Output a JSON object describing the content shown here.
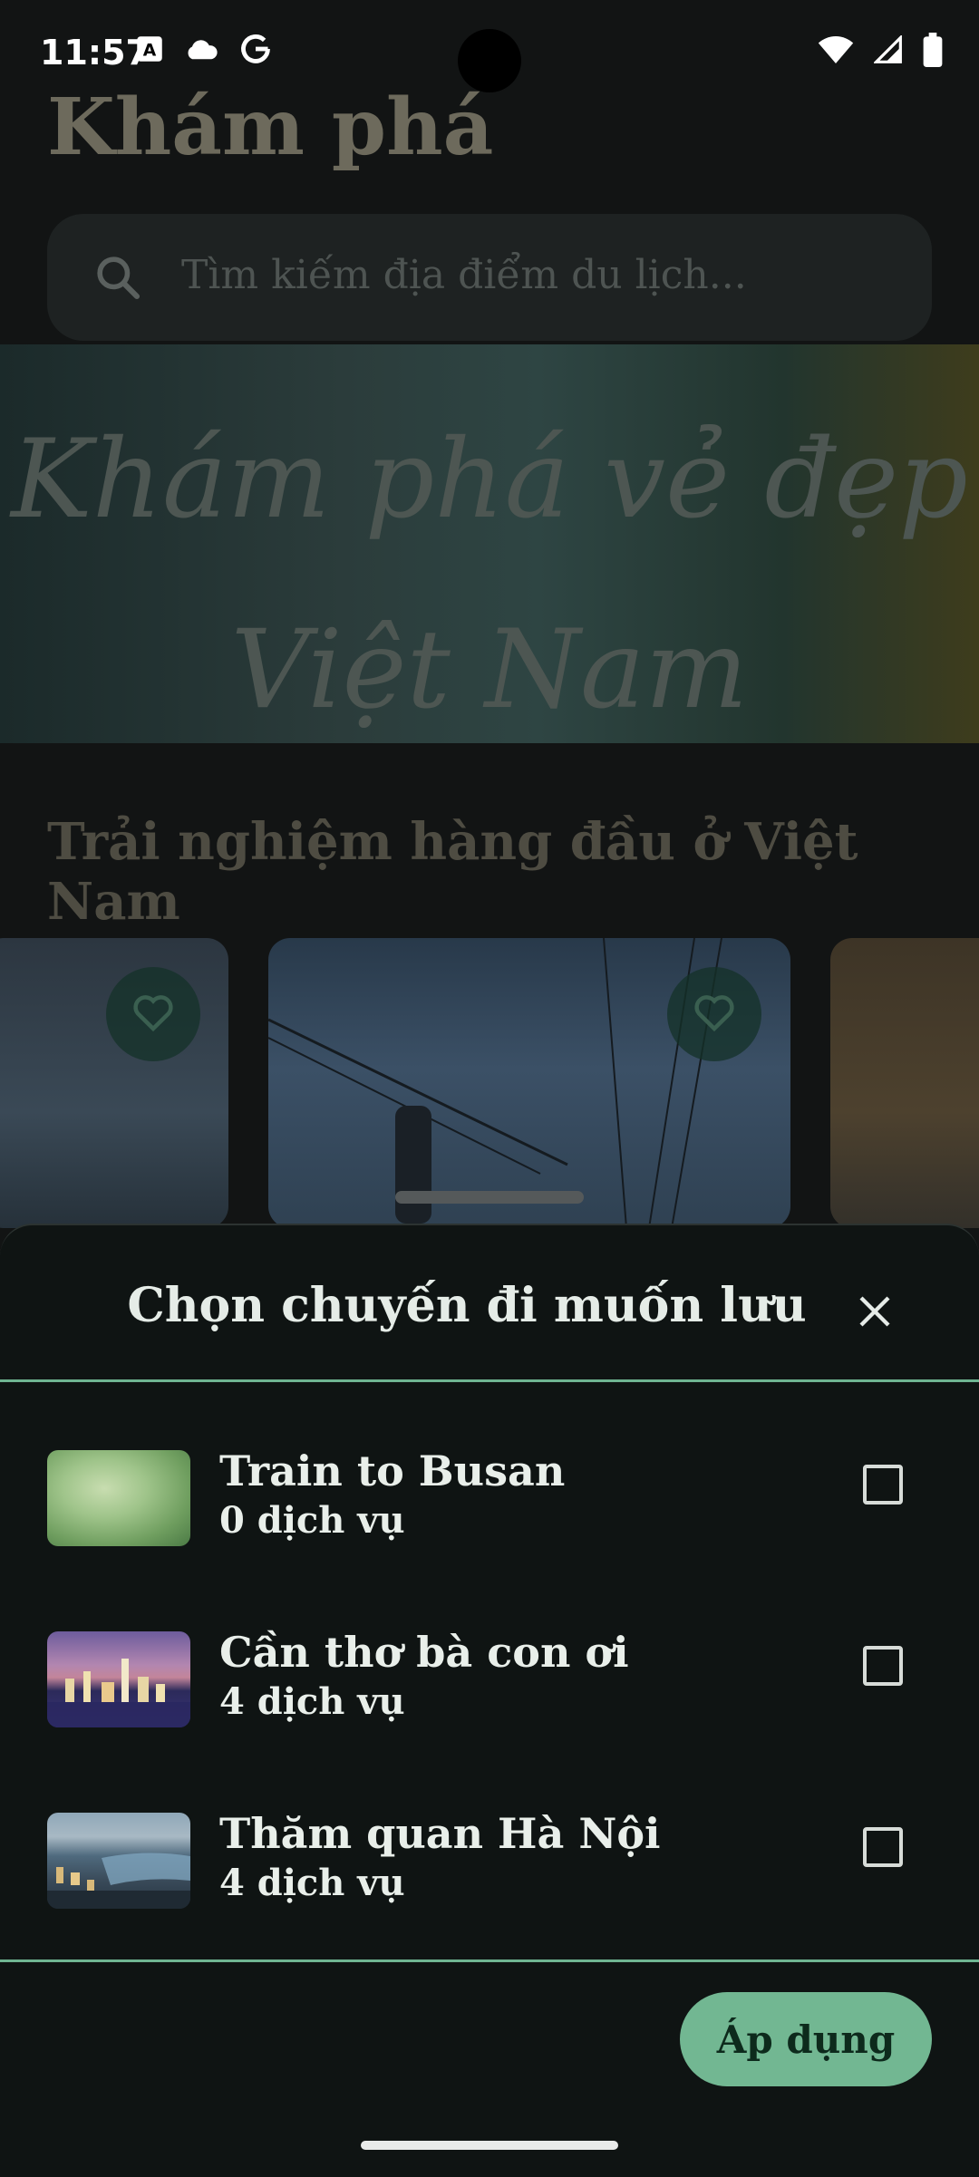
{
  "status_bar": {
    "time": "11:57"
  },
  "background": {
    "page_title": "Khám phá",
    "search_placeholder": "Tìm kiếm địa điểm du lịch...",
    "hero_line1": "Khám phá vẻ đẹp",
    "hero_line2": "Việt Nam",
    "section_title": "Trải nghiệm hàng đầu ở Việt Nam"
  },
  "sheet": {
    "title": "Chọn chuyến đi muốn lưu",
    "trips": [
      {
        "name": "Train to Busan",
        "count": "0 dịch vụ",
        "checked": false
      },
      {
        "name": "Cần thơ bà con ơi",
        "count": "4 dịch vụ",
        "checked": false
      },
      {
        "name": "Thăm quan Hà Nội",
        "count": "4 dịch vụ",
        "checked": false
      }
    ],
    "apply_label": "Áp dụng"
  },
  "colors": {
    "accent": "#72b792",
    "sheet_bg": "#0f1413"
  }
}
